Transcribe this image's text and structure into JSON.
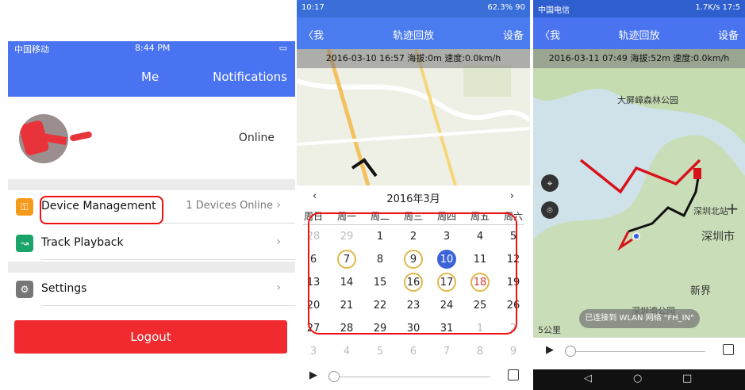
{
  "panel1": {
    "status": {
      "carrier": "中国移动",
      "time": "8:44 PM"
    },
    "nav": {
      "title": "Me",
      "notifications": "Notifications"
    },
    "profile": {
      "status": "Online"
    },
    "menu": [
      {
        "label": "Device Management",
        "value": "1 Devices Online",
        "chevron": "›"
      },
      {
        "label": "Track Playback",
        "value": "",
        "chevron": "›"
      },
      {
        "label": "Settings",
        "value": "",
        "chevron": "›"
      }
    ],
    "logout": "Logout"
  },
  "panel2": {
    "status": {
      "time": "10:17",
      "right": "62.3% 90"
    },
    "nav": {
      "back": "〈我",
      "title": "轨迹回放",
      "settings": "设备"
    },
    "info": "2016-03-10 16:57  海拔:0m  速度:0.0km/h",
    "calendar": {
      "prev": "‹",
      "next": "›",
      "month": "2016年3月",
      "weekdays": [
        "周日",
        "周一",
        "周二",
        "周三",
        "周四",
        "周五",
        "周六"
      ],
      "weeks": [
        [
          "28",
          "29",
          "1",
          "2",
          "3",
          "4",
          "5"
        ],
        [
          "6",
          "7",
          "8",
          "9",
          "10",
          "11",
          "12"
        ],
        [
          "13",
          "14",
          "15",
          "16",
          "17",
          "18",
          "19"
        ],
        [
          "20",
          "21",
          "22",
          "23",
          "24",
          "25",
          "26"
        ],
        [
          "27",
          "28",
          "29",
          "30",
          "31",
          "1",
          "2"
        ],
        [
          "3",
          "4",
          "5",
          "6",
          "7",
          "8",
          "9"
        ]
      ]
    },
    "play": "▶"
  },
  "panel3": {
    "status": {
      "carrier": "中国电信",
      "right": "1.7K/s 17:5"
    },
    "nav": {
      "back": "〈我",
      "title": "轨迹回放",
      "settings": "设备"
    },
    "info": "2016-03-11 07:49  海拔:52m  速度:0.0km/h",
    "map_labels": {
      "park": "大屏嶂森林公园",
      "city": "深圳市",
      "north": "深圳北站",
      "xinjie": "新界",
      "bay": "深圳湾公园",
      "scale": "5公里"
    },
    "toast": "已连接到 WLAN 网络 \"FH_IN\"",
    "play": "▶",
    "navbar": {
      "back": "◁",
      "home": "○",
      "recent": "□"
    }
  },
  "colors": {
    "ios_blue": "#4a73f2",
    "android_blue": "#4a7bef",
    "logout_red": "#f02a2e",
    "highlight_ring": "#e0b64a",
    "selected_day": "#3c63d8",
    "route_red": "#d8121b"
  }
}
